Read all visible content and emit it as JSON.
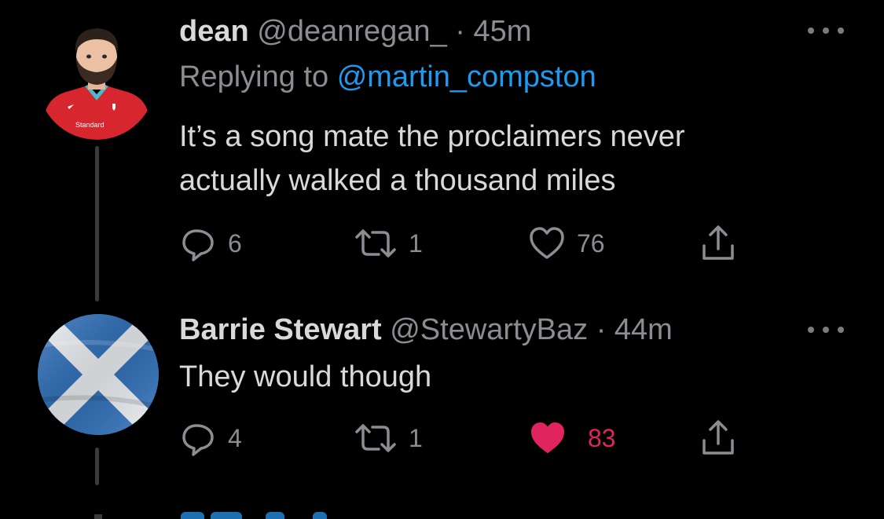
{
  "tweets": [
    {
      "display_name": "dean",
      "handle": "@deanregan_",
      "separator": "·",
      "time": "45m",
      "reply_prefix": "Replying to",
      "reply_to": "@martin_compston",
      "text_line1": "It’s a song mate the proclaimers never",
      "text_line2": "actually walked a thousand miles",
      "avatar_text": "Standard",
      "replies": "6",
      "retweets": "1",
      "likes": "76",
      "liked": false
    },
    {
      "display_name": "Barrie Stewart",
      "handle": "@StewartyBaz",
      "separator": "·",
      "time": "44m",
      "text_line1": "They would though",
      "replies": "4",
      "retweets": "1",
      "likes": "83",
      "liked": true
    }
  ],
  "colors": {
    "background": "#000000",
    "text": "#d9d9d9",
    "muted": "#8a8d91",
    "link": "#1d9bf0",
    "like": "#e0245e"
  },
  "icons": [
    "reply-icon",
    "retweet-icon",
    "like-icon",
    "share-icon",
    "more-icon"
  ]
}
